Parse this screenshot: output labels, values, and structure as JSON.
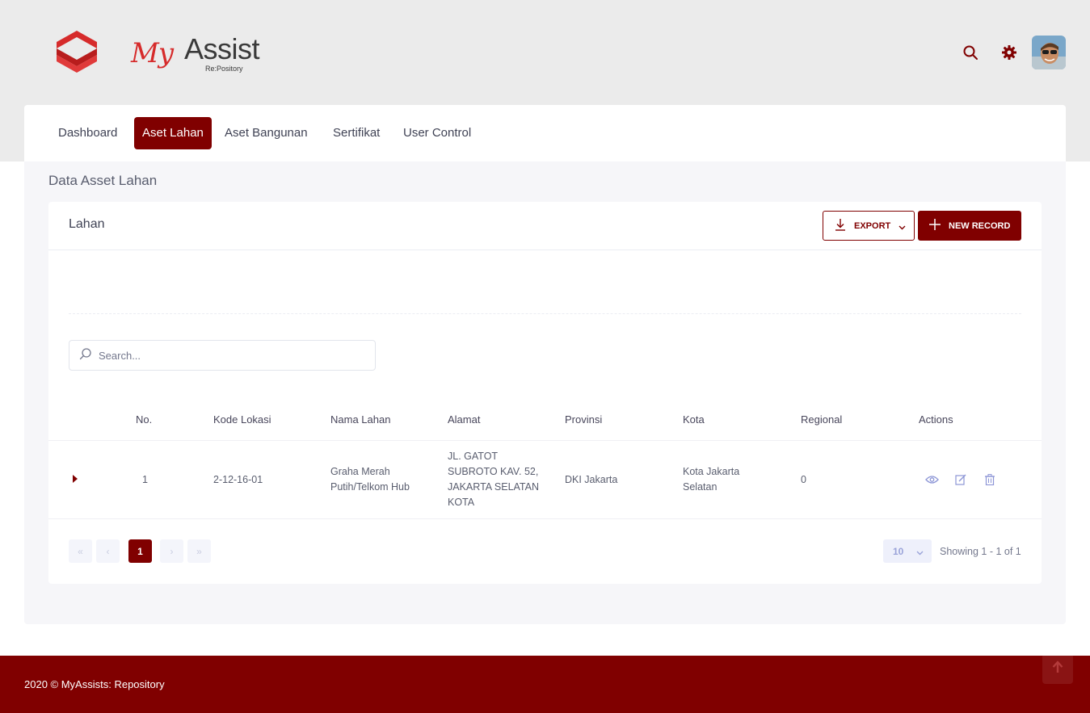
{
  "brand": {
    "name_script": "My",
    "name_main": "Assist",
    "tagline": "Re:Pository"
  },
  "header": {
    "search_icon": "search-icon",
    "settings_icon": "gear-icon",
    "accent": "#800000"
  },
  "nav": {
    "items": [
      {
        "label": "Dashboard"
      },
      {
        "label": "Aset Lahan"
      },
      {
        "label": "Aset Bangunan"
      },
      {
        "label": "Sertifikat"
      },
      {
        "label": "User Control"
      }
    ],
    "active": "Aset Lahan"
  },
  "page": {
    "title": "Data Asset Lahan"
  },
  "card": {
    "title": "Lahan",
    "export_label": "EXPORT",
    "new_record_label": "NEW RECORD"
  },
  "search": {
    "placeholder": "Search..."
  },
  "table": {
    "columns": [
      "No.",
      "Kode Lokasi",
      "Nama Lahan",
      "Alamat",
      "Provinsi",
      "Kota",
      "Regional",
      "Actions"
    ],
    "rows": [
      {
        "no": "1",
        "kode_lokasi": "2-12-16-01",
        "nama_lahan": [
          "Graha Merah",
          "Putih/Telkom Hub"
        ],
        "alamat": [
          "JL. GATOT",
          "SUBROTO KAV. 52,",
          "JAKARTA SELATAN",
          "KOTA"
        ],
        "provinsi": "DKI Jakarta",
        "kota": [
          "Kota Jakarta",
          "Selatan"
        ],
        "regional": "0"
      }
    ],
    "row_actions": [
      "eye-icon",
      "edit-icon",
      "trash-icon"
    ]
  },
  "pagination": {
    "first": "«",
    "prev": "‹",
    "current": "1",
    "next": "›",
    "last": "»",
    "page_size": "10",
    "showing": "Showing 1 - 1 of 1"
  },
  "footer": {
    "text": "2020 © MyAssists: Repository"
  }
}
